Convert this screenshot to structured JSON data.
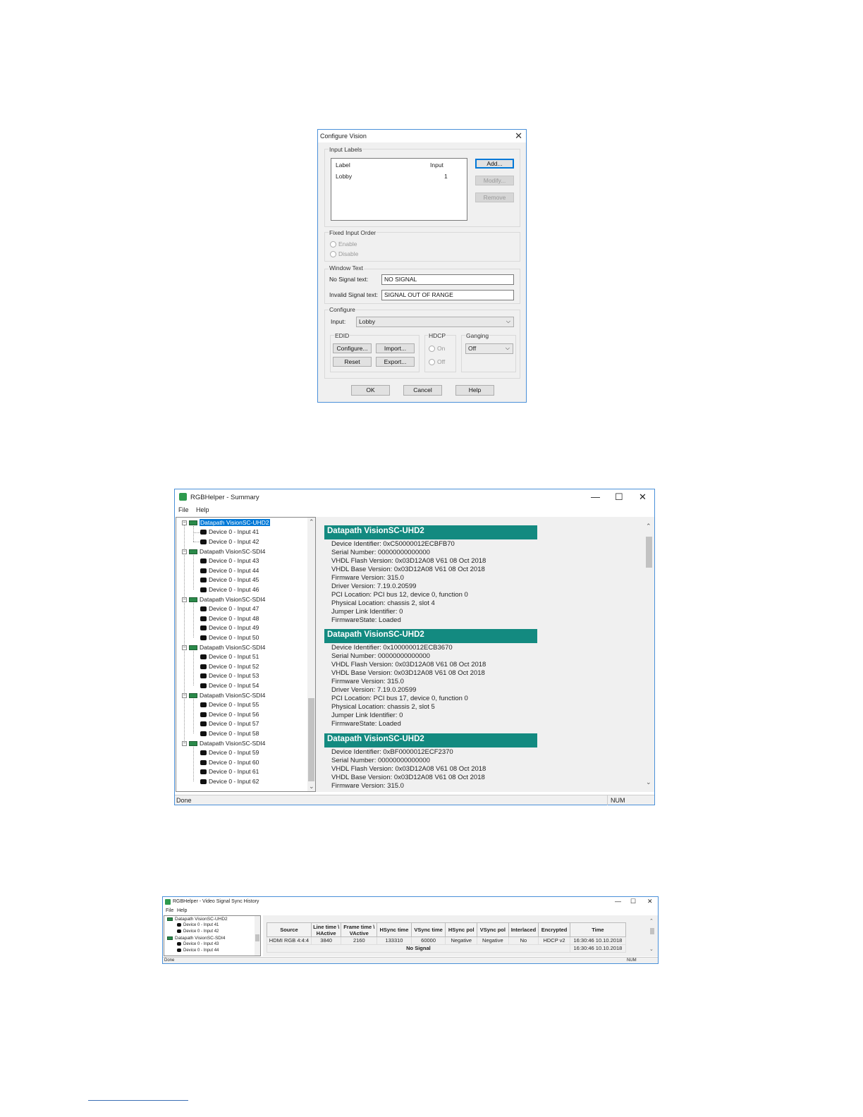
{
  "configure_dialog": {
    "title": "Configure Vision",
    "input_labels": {
      "group_label": "Input Labels",
      "col_label": "Label",
      "col_input": "Input",
      "rows": [
        {
          "label": "Lobby",
          "input": "1"
        }
      ],
      "add_button": "Add...",
      "modify_button": "Modify...",
      "remove_button": "Remove"
    },
    "fixed_input_order": {
      "group_label": "Fixed Input Order",
      "enable": "Enable",
      "disable": "Disable"
    },
    "window_text": {
      "group_label": "Window Text",
      "no_signal_label": "No Signal text:",
      "no_signal_value": "NO SIGNAL",
      "invalid_signal_label": "Invalid Signal text:",
      "invalid_signal_value": "SIGNAL OUT OF RANGE"
    },
    "configure": {
      "group_label": "Configure",
      "input_label": "Input:",
      "input_value": "Lobby",
      "edid_label": "EDID",
      "configure_button": "Configure...",
      "import_button": "Import...",
      "reset_button": "Reset",
      "export_button": "Export...",
      "hdcp_label": "HDCP",
      "hdcp_on": "On",
      "hdcp_off": "Off",
      "ganging_label": "Ganging",
      "ganging_value": "Off"
    },
    "ok_button": "OK",
    "cancel_button": "Cancel",
    "help_button": "Help"
  },
  "summary_window": {
    "title": "RGBHelper - Summary",
    "menu": [
      "File",
      "Help"
    ],
    "tree": [
      {
        "name": "Datapath VisionSC-UHD2",
        "selected": true,
        "children": [
          "Device 0 - Input 41",
          "Device 0 - Input 42"
        ]
      },
      {
        "name": "Datapath VisionSC-SDI4",
        "children": [
          "Device 0 - Input 43",
          "Device 0 - Input 44",
          "Device 0 - Input 45",
          "Device 0 - Input 46"
        ]
      },
      {
        "name": "Datapath VisionSC-SDI4",
        "children": [
          "Device 0 - Input 47",
          "Device 0 - Input 48",
          "Device 0 - Input 49",
          "Device 0 - Input 50"
        ]
      },
      {
        "name": "Datapath VisionSC-SDI4",
        "children": [
          "Device 0 - Input 51",
          "Device 0 - Input 52",
          "Device 0 - Input 53",
          "Device 0 - Input 54"
        ]
      },
      {
        "name": "Datapath VisionSC-SDI4",
        "children": [
          "Device 0 - Input 55",
          "Device 0 - Input 56",
          "Device 0 - Input 57",
          "Device 0 - Input 58"
        ]
      },
      {
        "name": "Datapath VisionSC-SDI4",
        "children": [
          "Device 0 - Input 59",
          "Device 0 - Input 60",
          "Device 0 - Input 61",
          "Device 0 - Input 62"
        ]
      }
    ],
    "devices": [
      {
        "header": "Datapath VisionSC-UHD2",
        "lines": [
          "Device Identifier: 0xC50000012ECBFB70",
          "Serial Number: 00000000000000",
          "VHDL Flash Version: 0x03D12A08 V61 08 Oct 2018",
          "VHDL Base Version: 0x03D12A08 V61 08 Oct 2018",
          "Firmware Version: 315.0",
          "Driver Version: 7.19.0.20599",
          "PCI Location: PCI bus 12, device 0, function 0",
          "Physical Location: chassis 2, slot 4",
          "Jumper Link Identifier: 0",
          "FirmwareState: Loaded"
        ]
      },
      {
        "header": "Datapath VisionSC-UHD2",
        "lines": [
          "Device Identifier: 0x100000012ECB3670",
          "Serial Number: 00000000000000",
          "VHDL Flash Version: 0x03D12A08 V61 08 Oct 2018",
          "VHDL Base Version: 0x03D12A08 V61 08 Oct 2018",
          "Firmware Version: 315.0",
          "Driver Version: 7.19.0.20599",
          "PCI Location: PCI bus 17, device 0, function 0",
          "Physical Location: chassis 2, slot 5",
          "Jumper Link Identifier: 0",
          "FirmwareState: Loaded"
        ]
      },
      {
        "header": "Datapath VisionSC-UHD2",
        "lines": [
          "Device Identifier: 0xBF0000012ECF2370",
          "Serial Number: 00000000000000",
          "VHDL Flash Version: 0x03D12A08 V61 08 Oct 2018",
          "VHDL Base Version: 0x03D12A08 V61 08 Oct 2018",
          "Firmware Version: 315.0"
        ]
      }
    ],
    "status_left": "Done",
    "status_right": "NUM"
  },
  "history_window": {
    "title": "RGBHelper - Video Signal Sync History",
    "menu": [
      "File",
      "Help"
    ],
    "tree": [
      {
        "name": "Datapath VisionSC-UHD2",
        "children": [
          "Device 0 - Input 41",
          "Device 0 - Input 42"
        ]
      },
      {
        "name": "Datapath VisionSC-SDI4",
        "children": [
          "Device 0 - Input 43",
          "Device 0 - Input 44"
        ]
      }
    ],
    "columns": [
      {
        "line1": "Source",
        "line2": ""
      },
      {
        "line1": "Line time \\",
        "line2": "HActive"
      },
      {
        "line1": "Frame time \\",
        "line2": "VActive"
      },
      {
        "line1": "HSync time",
        "line2": ""
      },
      {
        "line1": "VSync time",
        "line2": ""
      },
      {
        "line1": "HSync pol",
        "line2": ""
      },
      {
        "line1": "VSync pol",
        "line2": ""
      },
      {
        "line1": "Interlaced",
        "line2": ""
      },
      {
        "line1": "Encrypted",
        "line2": ""
      },
      {
        "line1": "Time",
        "line2": ""
      }
    ],
    "rows": [
      [
        "HDMI RGB 4:4:4",
        "3840",
        "2160",
        "133310",
        "60000",
        "Negative",
        "Negative",
        "No",
        "HDCP v2",
        "16:30:46 10.10.2018"
      ]
    ],
    "no_signal_text": "No Signal",
    "no_signal_time": "16:30:46 10.10.2018",
    "status_left": "Done",
    "status_right": "NUM"
  },
  "colors": {
    "device_header": "#138a80",
    "window_border": "#4a90d9",
    "selection": "#0078d7"
  }
}
